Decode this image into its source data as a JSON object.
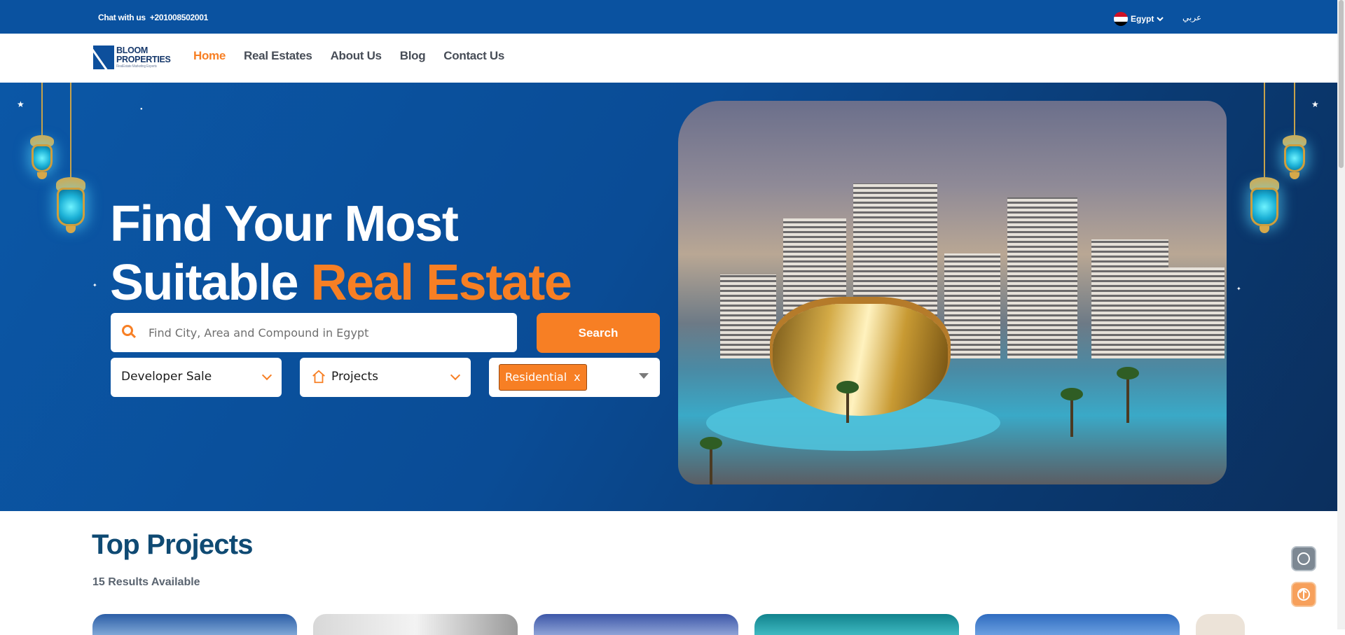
{
  "topbar": {
    "chat_label": "Chat with us",
    "phone": "+201008502001",
    "country": "Egypt",
    "language": "عربي",
    "background_color": "#0a52a0"
  },
  "logo": {
    "line1": "BLOOM",
    "line2": "PROPERTIES",
    "tagline": "RealEstate Marketing Experts"
  },
  "nav": {
    "items": [
      "Home",
      "Real Estates",
      "About Us",
      "Blog",
      "Contact Us"
    ],
    "active": "Home",
    "accent_color": "#f77f24"
  },
  "hero": {
    "headline_part1": "Find Your Most",
    "headline_part2": "Suitable ",
    "headline_accent": "Real Estate",
    "search_placeholder": "Find City, Area and Compound in Egypt",
    "search_button": "Search",
    "filter_sale": "Developer Sale",
    "filter_type": "Projects",
    "filter_tag": "Residential",
    "filter_tag_remove": "x"
  },
  "section": {
    "title": "Top Projects",
    "results": "15 Results Available"
  },
  "icons": {
    "search": "search-icon",
    "home": "home-icon",
    "chevron": "chevron-down-icon",
    "refresh": "refresh-icon",
    "up": "arrow-up-icon"
  }
}
